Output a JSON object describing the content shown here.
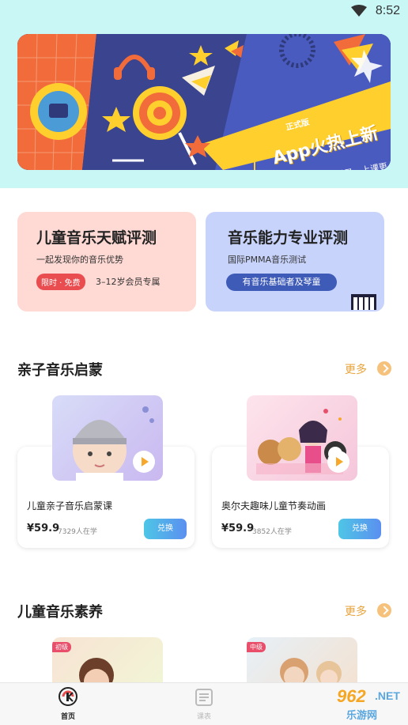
{
  "status_bar": {
    "time": "8:52"
  },
  "banner": {
    "badge": "正式版",
    "title": "App火热上新",
    "subtitle": "独立账号登录，上课更省心",
    "colors": {
      "left_panel": "#f26b3a",
      "main": "#2f3a7a",
      "yellow_ribbon": "#ffcf2e",
      "accent_blue": "#4a5bc0"
    }
  },
  "evaluations": [
    {
      "title": "儿童音乐天赋评测",
      "desc": "一起发现你的音乐优势",
      "tag": "限时 · 免费",
      "tag_text": "3–12岁会员专属"
    },
    {
      "title": "音乐能力专业评测",
      "desc": "国际PMMA音乐测试",
      "button": "有音乐基础者及琴童",
      "icon": "piano-icon"
    }
  ],
  "sections": {
    "enlightenment": {
      "title": "亲子音乐启蒙",
      "more": "更多",
      "courses": [
        {
          "name": "儿童亲子音乐启蒙课",
          "price": "¥59.9",
          "learners": "7329人在学",
          "button": "兑换"
        },
        {
          "name": "奥尔夫趣味儿童节奏动画",
          "price": "¥59.9",
          "learners": "3852人在学",
          "button": "兑换"
        }
      ]
    },
    "literacy": {
      "title": "儿童音乐素养",
      "more": "更多",
      "levels": [
        "初级",
        "中级"
      ]
    }
  },
  "tab_bar": {
    "home": "首页",
    "course": "课表"
  },
  "watermark": {
    "num": "962",
    "net": ".NET",
    "cn": "乐游网"
  }
}
